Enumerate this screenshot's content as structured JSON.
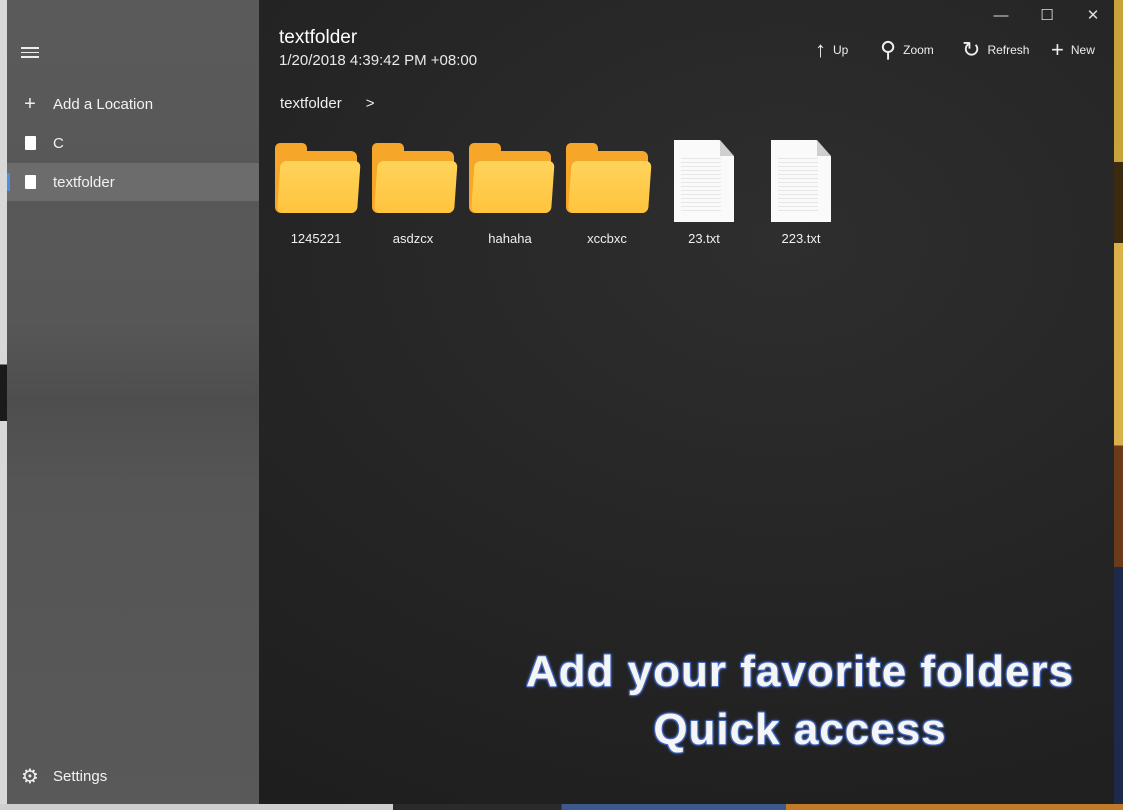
{
  "window": {
    "controls": [
      "minimize",
      "maximize",
      "close"
    ]
  },
  "sidebar": {
    "menu_icon": "hamburger-icon",
    "items": [
      {
        "label": "Add a Location",
        "icon": "plus-icon"
      },
      {
        "label": "C",
        "icon": "document-icon"
      },
      {
        "label": "textfolder",
        "icon": "document-icon",
        "selected": true
      }
    ],
    "settings": {
      "label": "Settings",
      "icon": "gear-icon"
    }
  },
  "header": {
    "title": "textfolder",
    "subtitle": "1/20/2018 4:39:42 PM +08:00"
  },
  "toolbar": {
    "up": "Up",
    "zoom": "Zoom",
    "refresh": "Refresh",
    "new": "New"
  },
  "breadcrumb": {
    "segment": "textfolder",
    "separator": ">"
  },
  "items": [
    {
      "name": "1245221",
      "type": "folder"
    },
    {
      "name": "asdzcx",
      "type": "folder"
    },
    {
      "name": "hahaha",
      "type": "folder"
    },
    {
      "name": "xccbxc",
      "type": "folder"
    },
    {
      "name": "23.txt",
      "type": "file"
    },
    {
      "name": "223.txt",
      "type": "file"
    }
  ],
  "promo": {
    "line1": "Add your favorite folders",
    "line2": "Quick access"
  },
  "colors": {
    "folder": "#ffc43e",
    "accent": "#4a90e2"
  }
}
